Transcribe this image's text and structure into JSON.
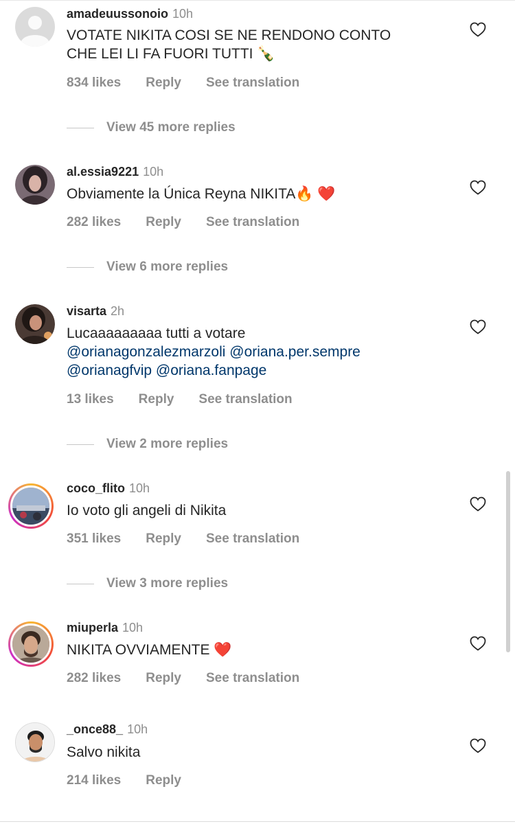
{
  "comments": [
    {
      "username": "amadeuussonoio",
      "time": "10h",
      "text_lines": [
        "VOTATE NIKITA COSI SE NE RENDONO CONTO",
        "CHE LEI LI FA FUORI TUTTI 🍾"
      ],
      "likes": "834 likes",
      "reply_label": "Reply",
      "translate_label": "See translation",
      "view_replies": "View 45 more replies",
      "avatar": "default-avatar"
    },
    {
      "username": "al.essia9221",
      "time": "10h",
      "text_lines": [
        "Obviamente la Única Reyna NIKITA🔥 ❤️"
      ],
      "likes": "282 likes",
      "reply_label": "Reply",
      "translate_label": "See translation",
      "view_replies": "View 6 more replies",
      "avatar": "photo-avatar"
    },
    {
      "username": "visarta",
      "time": "2h",
      "text_line_1": "Lucaaaaaaaaa tutti a votare",
      "mentions_line_2": [
        "@orianagonzalezmarzoli",
        "@oriana.per.sempre"
      ],
      "mentions_line_3": [
        "@orianagfvip",
        "@oriana.fanpage"
      ],
      "likes": "13 likes",
      "reply_label": "Reply",
      "translate_label": "See translation",
      "view_replies": "View 2 more replies",
      "avatar": "photo-avatar"
    },
    {
      "username": "coco_flito",
      "time": "10h",
      "text_lines": [
        "Io voto gli angeli di Nikita"
      ],
      "likes": "351 likes",
      "reply_label": "Reply",
      "translate_label": "See translation",
      "view_replies": "View 3 more replies",
      "avatar": "story-avatar"
    },
    {
      "username": "miuperla",
      "time": "10h",
      "text_lines": [
        "NIKITA OVVIAMENTE ❤️"
      ],
      "likes": "282 likes",
      "reply_label": "Reply",
      "translate_label": "See translation",
      "avatar": "story-avatar"
    },
    {
      "username": "_once88_",
      "time": "10h",
      "text_lines": [
        "Salvo nikita"
      ],
      "likes": "214 likes",
      "reply_label": "Reply",
      "avatar": "photo-avatar"
    }
  ],
  "colors": {
    "text": "#262626",
    "muted": "#8e8e8e",
    "mention": "#00376b"
  }
}
